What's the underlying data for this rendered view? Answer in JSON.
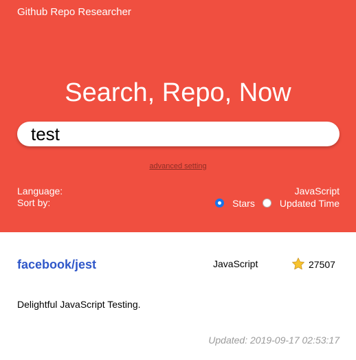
{
  "app": {
    "title": "Github Repo Researcher",
    "headline": "Search, Repo, Now"
  },
  "search": {
    "value": "test"
  },
  "advanced": {
    "label": "advanced setting"
  },
  "filters": {
    "language_label": "Language:",
    "language_value": "JavaScript",
    "sort_label": "Sort by:",
    "sort_options": [
      {
        "label": "Stars",
        "selected": true
      },
      {
        "label": "Updated Time",
        "selected": false
      }
    ]
  },
  "result": {
    "name": "facebook/jest",
    "language": "JavaScript",
    "stars": "27507",
    "description": "Delightful JavaScript Testing.",
    "updated": "Updated: 2019-09-17 02:53:17"
  },
  "colors": {
    "hero_background": "#f04f40",
    "repo_link": "#2f57c9",
    "radio_selected": "#1a73e8",
    "star": "#f7c32e"
  },
  "icons": {
    "star": "star-icon"
  }
}
